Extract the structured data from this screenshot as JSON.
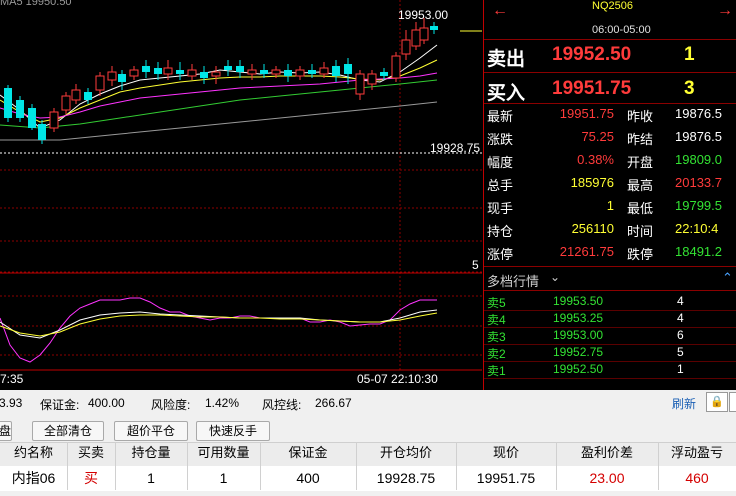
{
  "chart": {
    "top_indicator_text": "MA5 19950.50",
    "price_high_label": "19953.00",
    "price_ref_label": "19928.75",
    "mid_label": "5",
    "time_left": "7:35",
    "time_right": "05-07 22:10:30"
  },
  "quote": {
    "symbol": "NQ2506",
    "session": "06:00-05:00",
    "ask_label": "卖出",
    "ask_price": "19952.50",
    "ask_vol": "1",
    "bid_label": "买入",
    "bid_price": "19951.75",
    "bid_vol": "3",
    "rows": [
      {
        "l1": "最新",
        "v1": "19951.75",
        "c1": "red",
        "l2": "昨收",
        "v2": "19876.5",
        "c2": "white"
      },
      {
        "l1": "涨跌",
        "v1": "75.25",
        "c1": "red",
        "l2": "昨结",
        "v2": "19876.5",
        "c2": "white"
      },
      {
        "l1": "幅度",
        "v1": "0.38%",
        "c1": "red",
        "l2": "开盘",
        "v2": "19809.0",
        "c2": "green"
      },
      {
        "l1": "总手",
        "v1": "185976",
        "c1": "yellow",
        "l2": "最高",
        "v2": "20133.7",
        "c2": "red"
      },
      {
        "l1": "现手",
        "v1": "1",
        "c1": "yellow",
        "l2": "最低",
        "v2": "19799.5",
        "c2": "green"
      },
      {
        "l1": "持仓",
        "v1": "256110",
        "c1": "yellow",
        "l2": "时间",
        "v2": "22:10:4",
        "c2": "yellow"
      },
      {
        "l1": "涨停",
        "v1": "21261.75",
        "c1": "red",
        "l2": "跌停",
        "v2": "18491.2",
        "c2": "green"
      }
    ],
    "depth_title": "多档行情",
    "depth": [
      {
        "side": "卖5",
        "price": "19953.50",
        "vol": "4"
      },
      {
        "side": "卖4",
        "price": "19953.25",
        "vol": "4"
      },
      {
        "side": "卖3",
        "price": "19953.00",
        "vol": "6"
      },
      {
        "side": "卖2",
        "price": "19952.75",
        "vol": "5"
      },
      {
        "side": "卖1",
        "price": "19952.50",
        "vol": "1"
      }
    ]
  },
  "account": {
    "left_value": "3.93",
    "margin_label": "保证金:",
    "margin_value": "400.00",
    "risk_label": "风险度:",
    "risk_value": "1.42%",
    "control_label": "风控线:",
    "control_value": "266.67",
    "refresh": "刷新"
  },
  "buttons": {
    "partial": "盘",
    "close_all": "全部清仓",
    "super_close": "超价平仓",
    "quick_reverse": "快速反手"
  },
  "table": {
    "headers": [
      "约名称",
      "买卖",
      "持仓量",
      "可用数量",
      "保证金",
      "开仓均价",
      "现价",
      "盈利价差",
      "浮动盈亏"
    ],
    "row": [
      "内指06",
      "买",
      "1",
      "1",
      "400",
      "19928.75",
      "19951.75",
      "23.00",
      "460"
    ]
  },
  "colors": {
    "red": "#ff3b3b",
    "green": "#33e233",
    "yellow": "#ffff33",
    "cyan": "#00e6e6"
  }
}
